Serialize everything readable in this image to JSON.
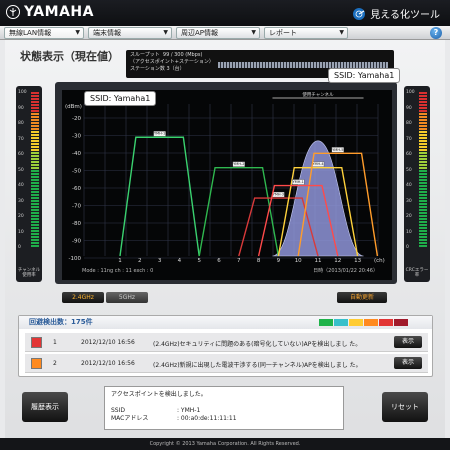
{
  "brand": {
    "logo_text": "YAMAHA",
    "app_title": "見える化ツール"
  },
  "nav": {
    "tabs": [
      {
        "label": "無線LAN情報"
      },
      {
        "label": "端末情報"
      },
      {
        "label": "周辺AP情報"
      },
      {
        "label": "レポート"
      }
    ],
    "help_label": "?"
  },
  "page": {
    "title": "状態表示（現在値）"
  },
  "stats": {
    "throughput_label": "スループット",
    "throughput_value": "99 / 300 (Mbps)",
    "subline": "（アクセスポイント+ステーション）",
    "station_label": "ステーション数",
    "station_value": "3（台）"
  },
  "callouts": {
    "left": "SSID: Yamaha1",
    "right": "SSID: Yamaha1"
  },
  "meters": {
    "left_caption": "チャンネル使用率",
    "right_caption": "CRCエラー率",
    "scale": [
      "100",
      "90",
      "80",
      "70",
      "60",
      "50",
      "40",
      "30",
      "20",
      "10",
      "0"
    ]
  },
  "chart_data": {
    "type": "area",
    "y_axis_title": "(dBm)",
    "x_axis_title": "(ch)",
    "ylim": [
      -100,
      -15
    ],
    "yticks": [
      "-20",
      "-30",
      "-40",
      "-50",
      "-60",
      "-70",
      "-80",
      "-90",
      "-100"
    ],
    "xticks": [
      "1",
      "2",
      "3",
      "4",
      "5",
      "6",
      "7",
      "8",
      "9",
      "10",
      "11",
      "12",
      "13"
    ],
    "mode_text": "Mode : 11ng   ch : 11   exch : 0",
    "date_text": "日時（2013/01/22 20:46）",
    "band_label": "使用チャンネル",
    "series": [
      {
        "name": "YMH-1",
        "color": "#3ad16f",
        "center": 3,
        "level": -28
      },
      {
        "name": "YMH-2",
        "color": "#2fb84f",
        "center": 7,
        "level": -45
      },
      {
        "name": "YMH-3",
        "color": "#d83a3a",
        "center": 9,
        "level": -62
      },
      {
        "name": "YMH-4",
        "color": "#ffd23c",
        "center": 11,
        "level": -45
      },
      {
        "name": "YMH-5",
        "color": "#ff9c2b",
        "center": 12,
        "level": -37
      },
      {
        "name": "YMH-1",
        "color": "#ff4a4a",
        "center": 10,
        "level": -55
      }
    ],
    "own_channel": {
      "center": 11,
      "level": -30,
      "color": "#8f95d8"
    }
  },
  "band": {
    "active": "2.4GHz",
    "inactive": "5GHz",
    "update": "自動更新"
  },
  "detection": {
    "title": "回避検出数：175件",
    "legend_colors": [
      "#1fb34a",
      "#38c0ca",
      "#ffcc33",
      "#ff8a1f",
      "#e23535",
      "#a11a2b"
    ],
    "rows": [
      {
        "num": "1",
        "timestamp": "2012/12/10 16:56",
        "message": "(2.4GHz)セキュリティに問題のある(暗号化していない)APを検出しまし た。",
        "color": "#e23535",
        "show_label": "表示"
      },
      {
        "num": "2",
        "timestamp": "2012/12/10 16:56",
        "message": "(2.4GHz)新規に出現した電波干渉する(同一チャンネル)APを検出しまし た。",
        "color": "#ff8a1f",
        "show_label": "表示"
      }
    ]
  },
  "bottom": {
    "history_button": "履歴表示",
    "reset_button": "リセット",
    "info_line": "アクセスポイントを検出しました。",
    "ssid_key": "SSID",
    "ssid_value": ": YMH-1",
    "mac_key": "MACアドレス",
    "mac_value": ": 00:a0:de:11:11:11"
  },
  "footer": "Copyright © 2013 Yamaha Corporation. All Rights Reserved."
}
